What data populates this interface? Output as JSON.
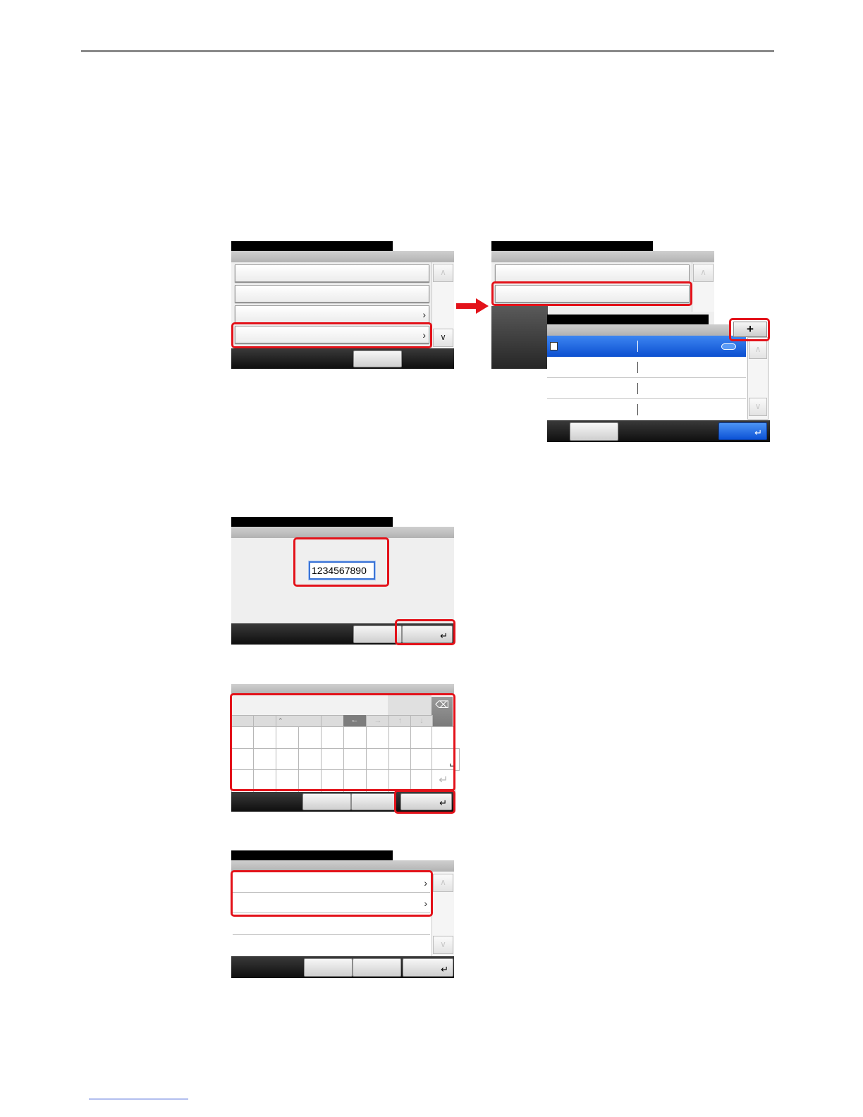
{
  "colors": {
    "highlight": "#e3121a",
    "selection": "#1560e0",
    "arrow": "#e3121a"
  },
  "icons": {
    "more": "chevron-right-icon",
    "scroll_up": "chevron-up-icon",
    "scroll_down": "chevron-down-icon",
    "add": "plus-icon",
    "enter": "enter-icon",
    "backspace": "backspace-icon",
    "space": "space-icon",
    "next_step": "arrow-right-icon",
    "address_book": "address-book-icon"
  },
  "panels": {
    "add_button_label": "+",
    "number_field": {
      "value": "1234567890"
    },
    "chevron_glyph": "›",
    "enter_glyph": "↵",
    "space_glyph": "␣",
    "plus_glyph": "+",
    "up_glyph": "∧",
    "down_glyph": "∨",
    "left_arrow": "←",
    "right_arrow": "→",
    "up_arrow": "↑",
    "down_arrow": "↓",
    "caret_glyph": "⌃"
  }
}
